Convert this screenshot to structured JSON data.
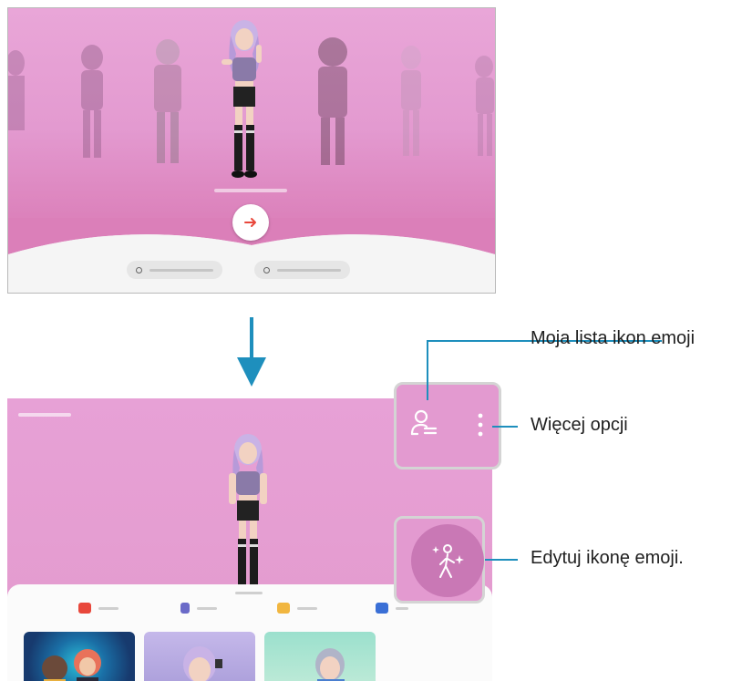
{
  "callouts": {
    "my_emoji_list": "Moja lista ikon emoji",
    "more_options": "Więcej opcji",
    "edit_emoji": "Edytuj ikonę emoji."
  },
  "icons": {
    "arrow": "arrow-right-icon",
    "my_emoji_list": "person-list-icon",
    "more_options": "more-vertical-icon",
    "edit_emoji": "person-sparkle-icon",
    "flow": "arrow-down-icon"
  },
  "colors": {
    "accent_line": "#1e8fbd",
    "stage_pink": "#e39ad0",
    "arrow_red": "#e8473b"
  }
}
